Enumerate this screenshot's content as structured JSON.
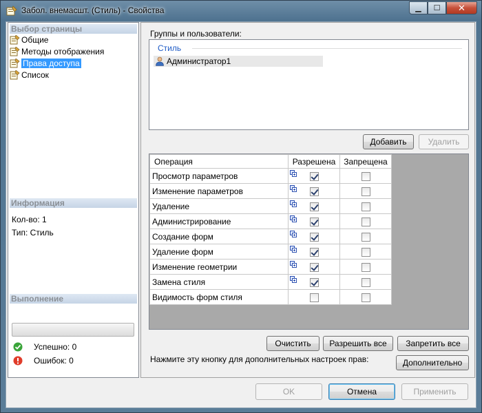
{
  "window": {
    "title": "Забол. внемасшт. (Стиль) - Свойства"
  },
  "window_buttons": {
    "minimize": "▁",
    "maximize": "☐",
    "close": "✕"
  },
  "left": {
    "nav_header": "Выбор страницы",
    "nav_items": [
      {
        "label": "Общие",
        "selected": false
      },
      {
        "label": "Методы отображения",
        "selected": false
      },
      {
        "label": "Права доступа",
        "selected": true
      },
      {
        "label": "Список",
        "selected": false
      }
    ],
    "info_header": "Информация",
    "info_count": "Кол-во: 1",
    "info_type": "Тип: Стиль",
    "exec_header": "Выполнение",
    "success": "Успешно: 0",
    "errors": "Ошибок: 0"
  },
  "right": {
    "groups_label": "Группы и пользователи:",
    "group_caption": "Стиль",
    "group_user": "Администратор1",
    "add_button": "Добавить",
    "remove_button": "Удалить",
    "table": {
      "headers": [
        "Операция",
        "Разрешена",
        "Запрещена"
      ],
      "rows": [
        {
          "op": "Просмотр параметров",
          "allowed": true,
          "denied": false,
          "mark": true
        },
        {
          "op": "Изменение параметров",
          "allowed": true,
          "denied": false,
          "mark": true
        },
        {
          "op": "Удаление",
          "allowed": true,
          "denied": false,
          "mark": true
        },
        {
          "op": "Администрирование",
          "allowed": true,
          "denied": false,
          "mark": true
        },
        {
          "op": "Создание форм",
          "allowed": true,
          "denied": false,
          "mark": true
        },
        {
          "op": "Удаление форм",
          "allowed": true,
          "denied": false,
          "mark": true
        },
        {
          "op": "Изменение геометрии",
          "allowed": true,
          "denied": false,
          "mark": true
        },
        {
          "op": "Замена стиля",
          "allowed": true,
          "denied": false,
          "mark": true
        },
        {
          "op": "Видимость форм стиля",
          "allowed": false,
          "denied": false,
          "mark": false
        }
      ]
    },
    "clear_button": "Очистить",
    "allow_all_button": "Разрешить все",
    "deny_all_button": "Запретить все",
    "hint": "Нажмите эту кнопку для дополнительных настроек прав:",
    "advanced_button": "Дополнительно"
  },
  "footer": {
    "ok": "OK",
    "cancel": "Отмена",
    "apply": "Применить"
  },
  "colors": {
    "selection": "#3399ff",
    "section_header": "#c5d4e6",
    "grid_bg": "#a9a9a9"
  },
  "icons": {
    "app": "properties-icon",
    "nav": "properties-icon",
    "user": "user-icon",
    "success": "check-circle-icon",
    "error": "error-circle-icon"
  }
}
